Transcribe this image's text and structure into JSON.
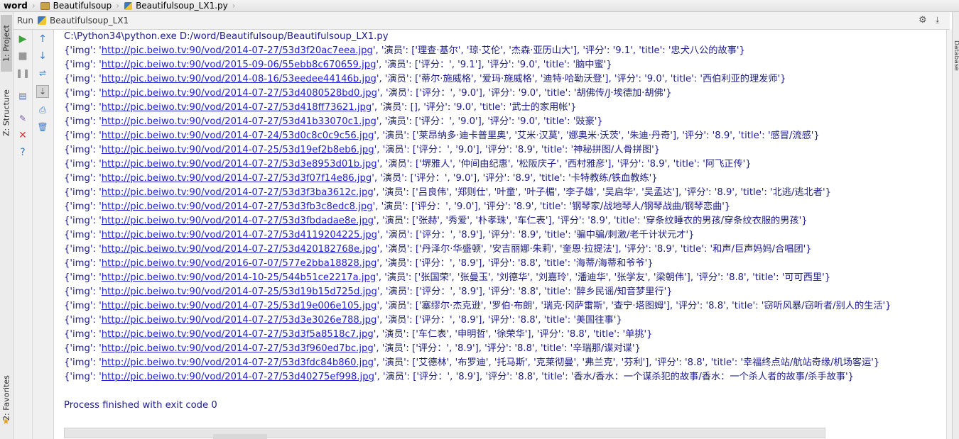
{
  "breadcrumb": [
    "word",
    "Beautifulsoup",
    "Beautifulsoup_LX1.py"
  ],
  "left_tabs": [
    "1: Project",
    "Z: Structure",
    "2: Favorites"
  ],
  "right_tab": "Database",
  "run_header": {
    "label": "Run",
    "config": "Beautifulsoup_LX1"
  },
  "console": {
    "command": "C:\\Python34\\python.exe D:/word/Beautifulsoup/Beautifulsoup_LX1.py",
    "records": [
      {
        "prefix": "{'img': '",
        "url": "http://pic.beiwo.tv:90/vod/2014-07-27/53d3f20ac7eea.jpg",
        "rest": "', '演员': ['理查·基尔', '琼·艾伦', '杰森·亚历山大'], '评分': '9.1', 'title': '忠犬八公的故事'}"
      },
      {
        "prefix": "{'img': '",
        "url": "http://pic.beiwo.tv:90/vod/2015-09-06/55ebb8c670659.jpg",
        "rest": "', '演员': ['评分：', '9.1'], '评分': '9.0', 'title': '脑中蜜'}"
      },
      {
        "prefix": "{'img': '",
        "url": "http://pic.beiwo.tv:90/vod/2014-08-16/53eedee44146b.jpg",
        "rest": "', '演员': ['蒂尔·施威格', '爱玛·施威格', '迪特·哈勒沃登'], '评分': '9.0', 'title': '西伯利亚的理发师'}"
      },
      {
        "prefix": "{'img': '",
        "url": "http://pic.beiwo.tv:90/vod/2014-07-27/53d4080528bd0.jpg",
        "rest": "', '演员': ['评分：', '9.0'], '评分': '9.0', 'title': '胡佛传/J·埃德加·胡佛'}"
      },
      {
        "prefix": "{'img': '",
        "url": "http://pic.beiwo.tv:90/vod/2014-07-27/53d418ff73621.jpg",
        "rest": "', '演员': [], '评分': '9.0', 'title': '武士的家用帐'}"
      },
      {
        "prefix": "{'img': '",
        "url": "http://pic.beiwo.tv:90/vod/2014-07-27/53d41b33070c1.jpg",
        "rest": "', '演员': ['评分：', '9.0'], '评分': '9.0', 'title': '豉豪'}"
      },
      {
        "prefix": "{'img': '",
        "url": "http://pic.beiwo.tv:90/vod/2014-07-24/53d0c8c0c9c56.jpg",
        "rest": "', '演员': ['莱昂纳多·迪卡普里奥', '艾米·汉莫', '娜奥米·沃茨', '朱迪·丹奇'], '评分': '8.9', 'title': '感冒/流感'}"
      },
      {
        "prefix": "{'img': '",
        "url": "http://pic.beiwo.tv:90/vod/2014-07-25/53d19ef2b8eb6.jpg",
        "rest": "', '演员': ['评分：', '9.0'], '评分': '8.9', 'title': '神秘拼图/人骨拼图'}"
      },
      {
        "prefix": "{'img': '",
        "url": "http://pic.beiwo.tv:90/vod/2014-07-27/53d3e8953d01b.jpg",
        "rest": "', '演员': ['堺雅人', '仲间由纪惠', '松阪庆子', '西村雅彦'], '评分': '8.9', 'title': '阿飞正传'}"
      },
      {
        "prefix": "{'img': '",
        "url": "http://pic.beiwo.tv:90/vod/2014-07-27/53d3f07f14e86.jpg",
        "rest": "', '演员': ['评分：', '9.0'], '评分': '8.9', 'title': '卡特教练/铁血教练'}"
      },
      {
        "prefix": "{'img': '",
        "url": "http://pic.beiwo.tv:90/vod/2014-07-27/53d3f3ba3612c.jpg",
        "rest": "', '演员': ['吕良伟', '郑则仕', '叶童', '叶子楣', '李子雄', '吴启华', '吴孟达'], '评分': '8.9', 'title': '北逃/逃北者'}"
      },
      {
        "prefix": "{'img': '",
        "url": "http://pic.beiwo.tv:90/vod/2014-07-27/53d3fb3c8edc8.jpg",
        "rest": "', '演员': ['评分：', '9.0'], '评分': '8.9', 'title': '钢琴家/战地琴人/钢琴战曲/钢琴恋曲'}"
      },
      {
        "prefix": "{'img': '",
        "url": "http://pic.beiwo.tv:90/vod/2014-07-27/53d3fbdadae8e.jpg",
        "rest": "', '演员': ['张赫', '秀爱', '朴孝珠', '车仁表'], '评分': '8.9', 'title': '穿条纹睡衣的男孩/穿条纹衣服的男孩'}"
      },
      {
        "prefix": "{'img': '",
        "url": "http://pic.beiwo.tv:90/vod/2014-07-27/53d4119204225.jpg",
        "rest": "', '演员': ['评分：', '8.9'], '评分': '8.9', 'title': '骗中骗/刺激/老千计状元才'}"
      },
      {
        "prefix": "{'img': '",
        "url": "http://pic.beiwo.tv:90/vod/2014-07-27/53d420182768e.jpg",
        "rest": "', '演员': ['丹泽尔·华盛顿', '安吉丽娜·朱莉', '奎恩·拉提法'], '评分': '8.9', 'title': '和声/巨声妈妈/合唱团'}"
      },
      {
        "prefix": "{'img': '",
        "url": "http://pic.beiwo.tv:90/vod/2016-07-07/577e2bba18828.jpg",
        "rest": "', '演员': ['评分：', '8.9'], '评分': '8.8', 'title': '海蒂/海蒂和爷爷'}"
      },
      {
        "prefix": "{'img': '",
        "url": "http://pic.beiwo.tv:90/vod/2014-10-25/544b51ce2217a.jpg",
        "rest": "', '演员': ['张国荣', '张曼玉', '刘德华', '刘嘉玲', '潘迪华', '张学友', '梁朝伟'], '评分': '8.8', 'title': '可可西里'}"
      },
      {
        "prefix": "{'img': '",
        "url": "http://pic.beiwo.tv:90/vod/2014-07-25/53d19b15d725d.jpg",
        "rest": "', '演员': ['评分：', '8.9'], '评分': '8.8', 'title': '醉乡民谣/知音梦里行'}"
      },
      {
        "prefix": "{'img': '",
        "url": "http://pic.beiwo.tv:90/vod/2014-07-25/53d19e006e105.jpg",
        "rest": "', '演员': ['塞缪尔·杰克逊', '罗伯·布朗', '瑞克·冈萨雷斯', '查宁·塔图姆'], '评分': '8.8', 'title': '窃听风暴/窃听者/别人的生活'}"
      },
      {
        "prefix": "{'img': '",
        "url": "http://pic.beiwo.tv:90/vod/2014-07-27/53d3e3026e788.jpg",
        "rest": "', '演员': ['评分：', '8.9'], '评分': '8.8', 'title': '美国往事'}"
      },
      {
        "prefix": "{'img': '",
        "url": "http://pic.beiwo.tv:90/vod/2014-07-27/53d3f5a8518c7.jpg",
        "rest": "', '演员': ['车仁表', '申明哲', '徐荣华'], '评分': '8.8', 'title': '单挑'}"
      },
      {
        "prefix": "{'img': '",
        "url": "http://pic.beiwo.tv:90/vod/2014-07-27/53d3f960ed7bc.jpg",
        "rest": "', '演员': ['评分：', '8.9'], '评分': '8.8', 'title': '辛瑞那/谍对谍'}"
      },
      {
        "prefix": "{'img': '",
        "url": "http://pic.beiwo.tv:90/vod/2014-07-27/53d3fdc84b860.jpg",
        "rest": "', '演员': ['艾德林', '布罗迪', '托马斯', '克莱彻曼', '弗兰克', '芬利'], '评分': '8.8', 'title': '幸福终点站/航站奇缘/机场客运'}"
      },
      {
        "prefix": "{'img': '",
        "url": "http://pic.beiwo.tv:90/vod/2014-07-27/53d40275ef998.jpg",
        "rest": "', '演员': ['评分：', '8.9'], '评分': '8.8', 'title': '香水/香水：一个谋杀犯的故事/香水：一个杀人者的故事/杀手故事'}"
      }
    ],
    "exit_message": "Process finished with exit code 0"
  },
  "colors": {
    "link": "#1f1fd6",
    "console_text": "#1c1c8c"
  }
}
